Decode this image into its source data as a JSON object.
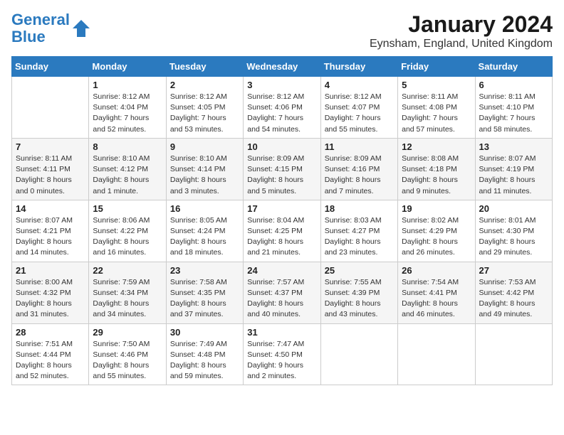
{
  "header": {
    "logo_line1": "General",
    "logo_line2": "Blue",
    "title": "January 2024",
    "subtitle": "Eynsham, England, United Kingdom"
  },
  "weekdays": [
    "Sunday",
    "Monday",
    "Tuesday",
    "Wednesday",
    "Thursday",
    "Friday",
    "Saturday"
  ],
  "weeks": [
    [
      {
        "day": "",
        "info": ""
      },
      {
        "day": "1",
        "info": "Sunrise: 8:12 AM\nSunset: 4:04 PM\nDaylight: 7 hours\nand 52 minutes."
      },
      {
        "day": "2",
        "info": "Sunrise: 8:12 AM\nSunset: 4:05 PM\nDaylight: 7 hours\nand 53 minutes."
      },
      {
        "day": "3",
        "info": "Sunrise: 8:12 AM\nSunset: 4:06 PM\nDaylight: 7 hours\nand 54 minutes."
      },
      {
        "day": "4",
        "info": "Sunrise: 8:12 AM\nSunset: 4:07 PM\nDaylight: 7 hours\nand 55 minutes."
      },
      {
        "day": "5",
        "info": "Sunrise: 8:11 AM\nSunset: 4:08 PM\nDaylight: 7 hours\nand 57 minutes."
      },
      {
        "day": "6",
        "info": "Sunrise: 8:11 AM\nSunset: 4:10 PM\nDaylight: 7 hours\nand 58 minutes."
      }
    ],
    [
      {
        "day": "7",
        "info": "Sunrise: 8:11 AM\nSunset: 4:11 PM\nDaylight: 8 hours\nand 0 minutes."
      },
      {
        "day": "8",
        "info": "Sunrise: 8:10 AM\nSunset: 4:12 PM\nDaylight: 8 hours\nand 1 minute."
      },
      {
        "day": "9",
        "info": "Sunrise: 8:10 AM\nSunset: 4:14 PM\nDaylight: 8 hours\nand 3 minutes."
      },
      {
        "day": "10",
        "info": "Sunrise: 8:09 AM\nSunset: 4:15 PM\nDaylight: 8 hours\nand 5 minutes."
      },
      {
        "day": "11",
        "info": "Sunrise: 8:09 AM\nSunset: 4:16 PM\nDaylight: 8 hours\nand 7 minutes."
      },
      {
        "day": "12",
        "info": "Sunrise: 8:08 AM\nSunset: 4:18 PM\nDaylight: 8 hours\nand 9 minutes."
      },
      {
        "day": "13",
        "info": "Sunrise: 8:07 AM\nSunset: 4:19 PM\nDaylight: 8 hours\nand 11 minutes."
      }
    ],
    [
      {
        "day": "14",
        "info": "Sunrise: 8:07 AM\nSunset: 4:21 PM\nDaylight: 8 hours\nand 14 minutes."
      },
      {
        "day": "15",
        "info": "Sunrise: 8:06 AM\nSunset: 4:22 PM\nDaylight: 8 hours\nand 16 minutes."
      },
      {
        "day": "16",
        "info": "Sunrise: 8:05 AM\nSunset: 4:24 PM\nDaylight: 8 hours\nand 18 minutes."
      },
      {
        "day": "17",
        "info": "Sunrise: 8:04 AM\nSunset: 4:25 PM\nDaylight: 8 hours\nand 21 minutes."
      },
      {
        "day": "18",
        "info": "Sunrise: 8:03 AM\nSunset: 4:27 PM\nDaylight: 8 hours\nand 23 minutes."
      },
      {
        "day": "19",
        "info": "Sunrise: 8:02 AM\nSunset: 4:29 PM\nDaylight: 8 hours\nand 26 minutes."
      },
      {
        "day": "20",
        "info": "Sunrise: 8:01 AM\nSunset: 4:30 PM\nDaylight: 8 hours\nand 29 minutes."
      }
    ],
    [
      {
        "day": "21",
        "info": "Sunrise: 8:00 AM\nSunset: 4:32 PM\nDaylight: 8 hours\nand 31 minutes."
      },
      {
        "day": "22",
        "info": "Sunrise: 7:59 AM\nSunset: 4:34 PM\nDaylight: 8 hours\nand 34 minutes."
      },
      {
        "day": "23",
        "info": "Sunrise: 7:58 AM\nSunset: 4:35 PM\nDaylight: 8 hours\nand 37 minutes."
      },
      {
        "day": "24",
        "info": "Sunrise: 7:57 AM\nSunset: 4:37 PM\nDaylight: 8 hours\nand 40 minutes."
      },
      {
        "day": "25",
        "info": "Sunrise: 7:55 AM\nSunset: 4:39 PM\nDaylight: 8 hours\nand 43 minutes."
      },
      {
        "day": "26",
        "info": "Sunrise: 7:54 AM\nSunset: 4:41 PM\nDaylight: 8 hours\nand 46 minutes."
      },
      {
        "day": "27",
        "info": "Sunrise: 7:53 AM\nSunset: 4:42 PM\nDaylight: 8 hours\nand 49 minutes."
      }
    ],
    [
      {
        "day": "28",
        "info": "Sunrise: 7:51 AM\nSunset: 4:44 PM\nDaylight: 8 hours\nand 52 minutes."
      },
      {
        "day": "29",
        "info": "Sunrise: 7:50 AM\nSunset: 4:46 PM\nDaylight: 8 hours\nand 55 minutes."
      },
      {
        "day": "30",
        "info": "Sunrise: 7:49 AM\nSunset: 4:48 PM\nDaylight: 8 hours\nand 59 minutes."
      },
      {
        "day": "31",
        "info": "Sunrise: 7:47 AM\nSunset: 4:50 PM\nDaylight: 9 hours\nand 2 minutes."
      },
      {
        "day": "",
        "info": ""
      },
      {
        "day": "",
        "info": ""
      },
      {
        "day": "",
        "info": ""
      }
    ]
  ]
}
